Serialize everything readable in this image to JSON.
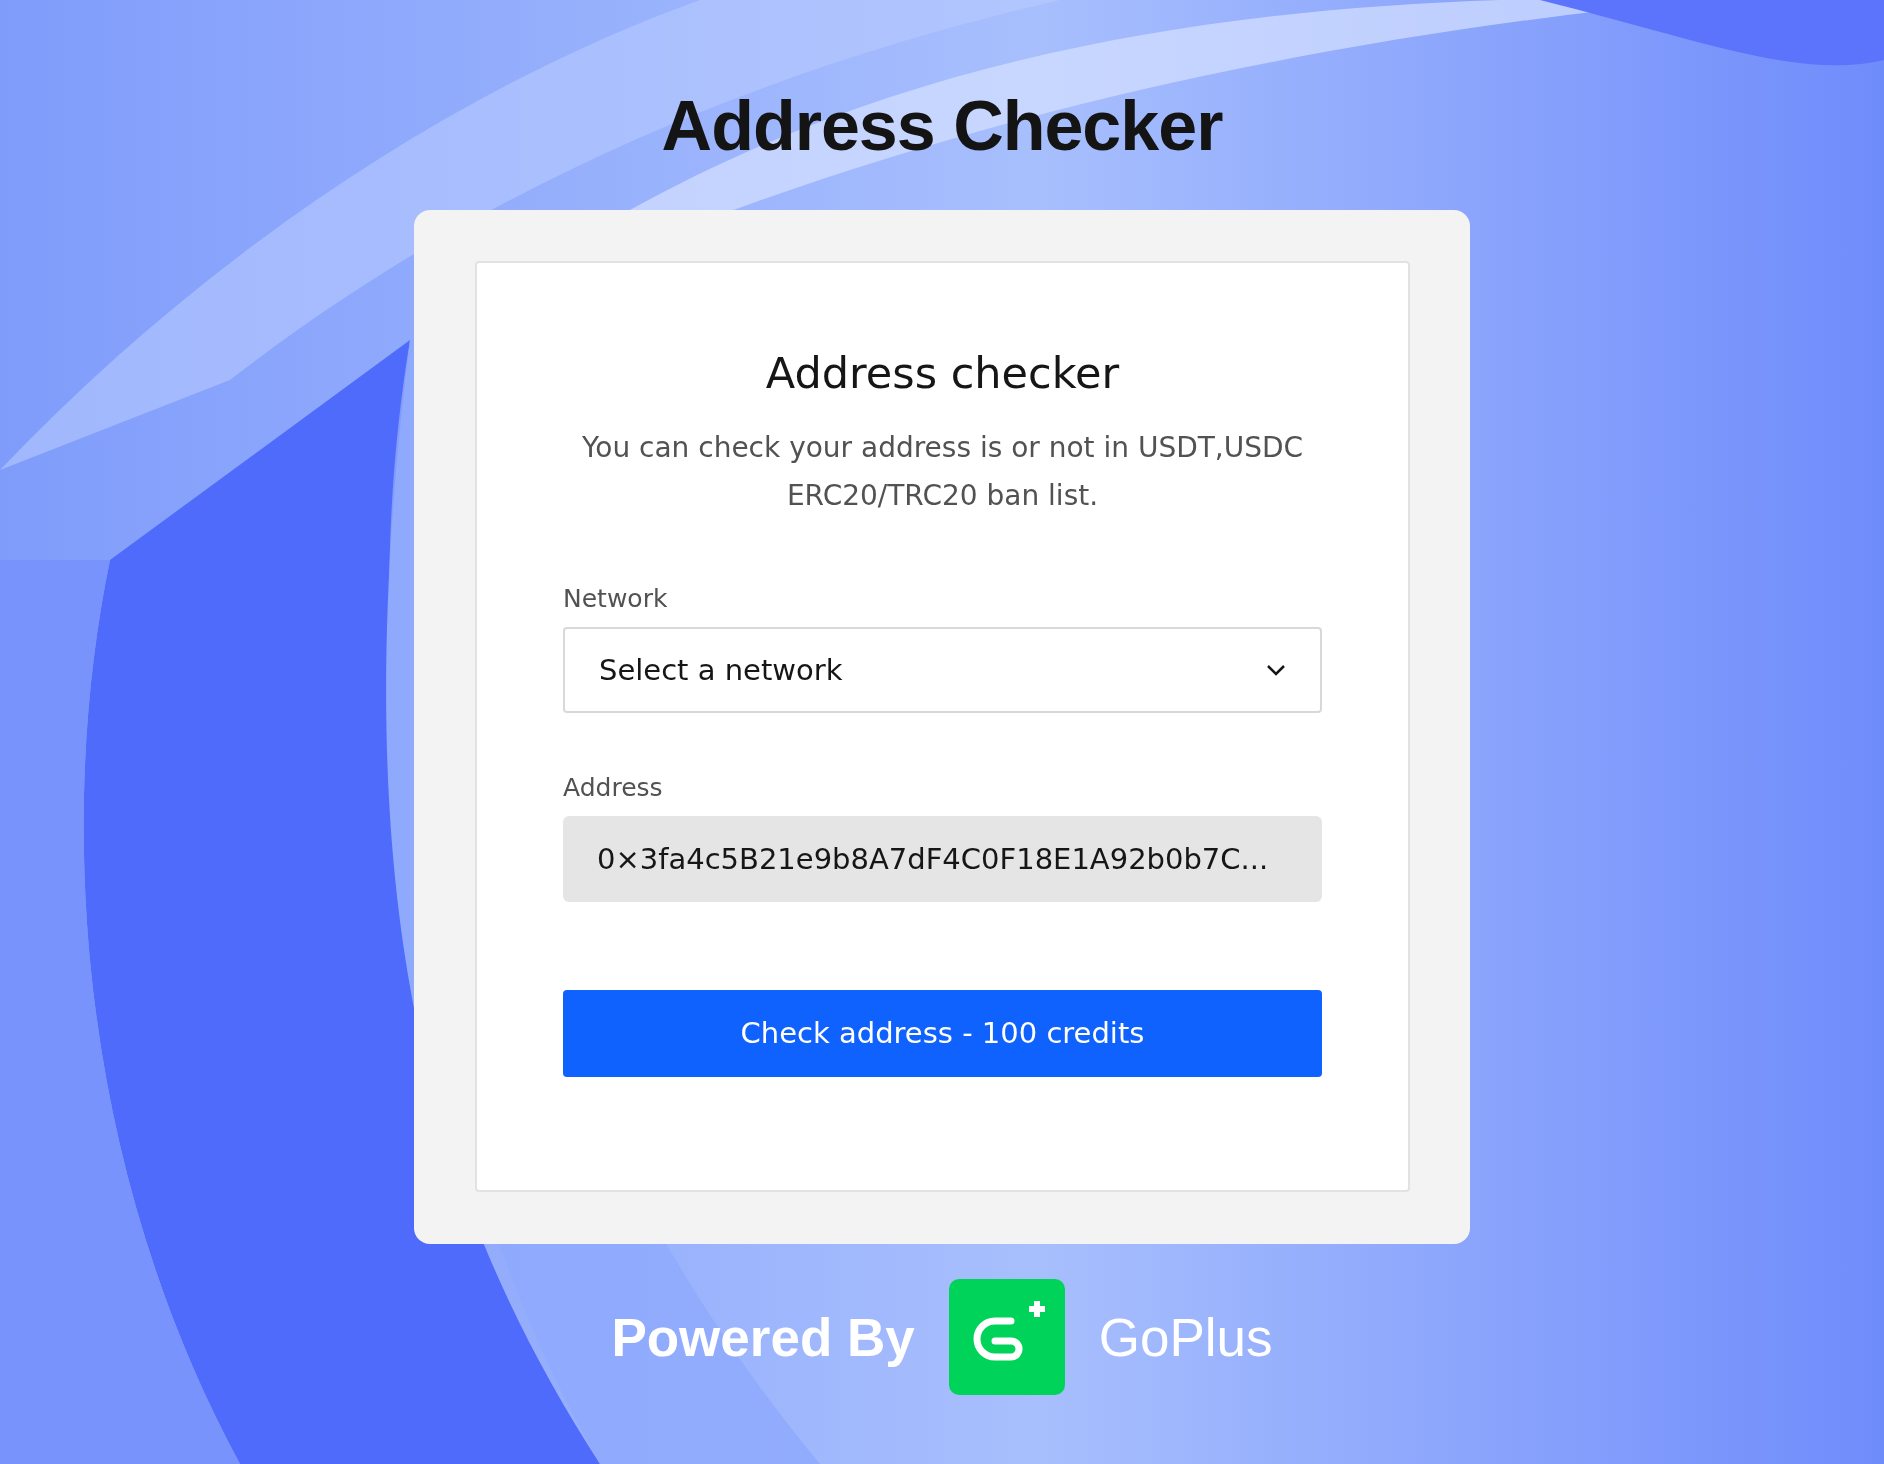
{
  "page_title": "Address Checker",
  "card": {
    "heading": "Address checker",
    "description": "You can check your address is or not in USDT,USDC ERC20/TRC20 ban list.",
    "network": {
      "label": "Network",
      "placeholder": "Select a network"
    },
    "address": {
      "label": "Address",
      "value": "0×3fa4c5B21e9b8A7dF4C0F18E1A92b0b7C...",
      "disabled": true
    },
    "submit": {
      "label": "Check address - 100 credits"
    }
  },
  "footer": {
    "powered_by": "Powered By",
    "brand": "GoPlus"
  }
}
